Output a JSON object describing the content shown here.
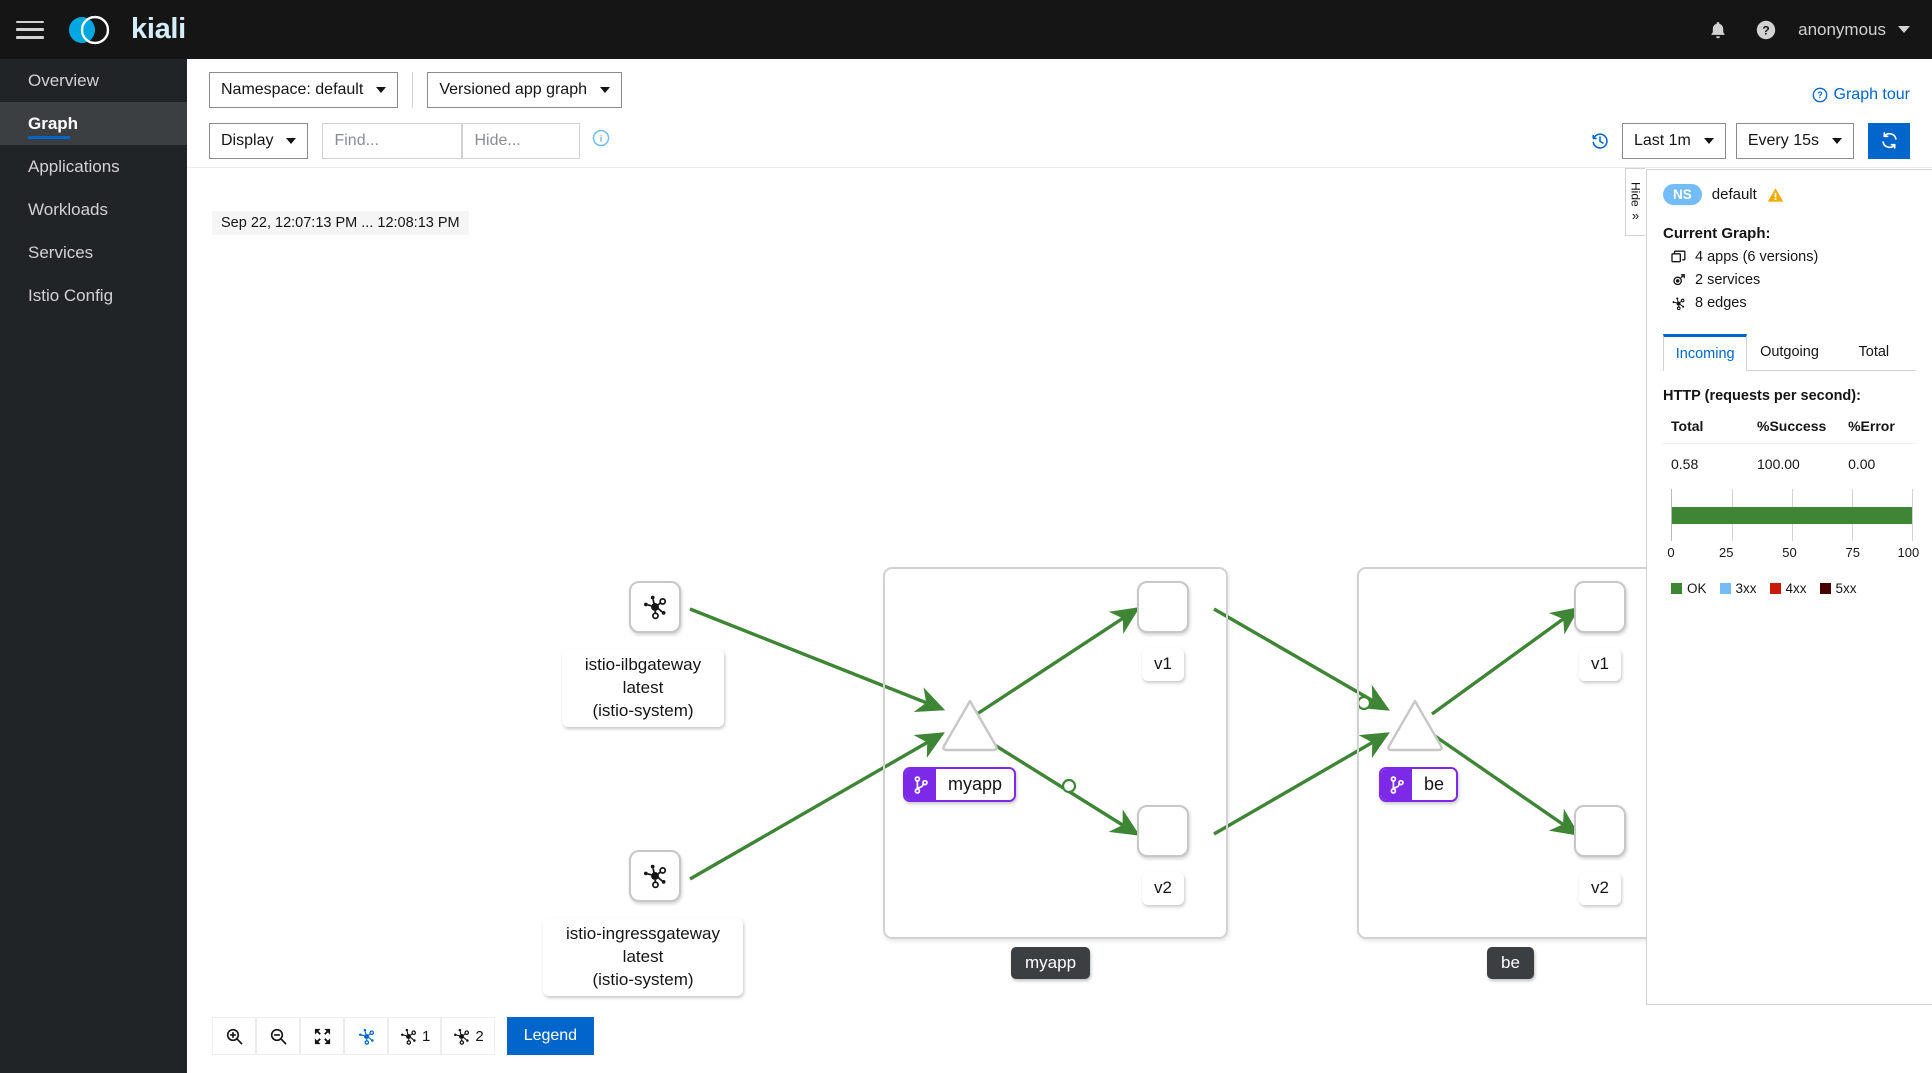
{
  "masthead": {
    "brand_name": "kiali",
    "hamburger_icon": "hamburger-menu-icon",
    "bell_icon": "notification-bell-icon",
    "help_icon": "help-question-icon",
    "user_name": "anonymous"
  },
  "sidebar": {
    "items": [
      {
        "label": "Overview",
        "active": false
      },
      {
        "label": "Graph",
        "active": true
      },
      {
        "label": "Applications",
        "active": false
      },
      {
        "label": "Workloads",
        "active": false
      },
      {
        "label": "Services",
        "active": false
      },
      {
        "label": "Istio Config",
        "active": false
      }
    ]
  },
  "toolbar": {
    "namespace_label": "Namespace: default",
    "graph_type_label": "Versioned app graph",
    "display_label": "Display",
    "find_placeholder": "Find...",
    "hide_placeholder": "Hide...",
    "find_value": "",
    "hide_value": "",
    "info_icon": "info-circle-icon",
    "graph_tour_label": "Graph tour",
    "graph_tour_icon": "help-question-icon",
    "history_icon": "clock-history-icon",
    "duration_label": "Last 1m",
    "refresh_interval_label": "Every 15s",
    "refresh_icon": "refresh-sync-icon"
  },
  "graph": {
    "timestamp": "Sep 22, 12:07:13 PM ... 12:08:13 PM",
    "gateways": [
      {
        "id": "istio-ilbgateway",
        "icon": "topology-node-icon",
        "label": "istio-ilbgateway\nlatest\n(istio-system)"
      },
      {
        "id": "istio-ingressgateway",
        "icon": "topology-node-icon",
        "label": "istio-ingressgateway\nlatest\n(istio-system)"
      }
    ],
    "apps": [
      {
        "id": "myapp",
        "group_label": "myapp",
        "service_label": "myapp",
        "service_badge_icon": "git-branch-icon",
        "versions": [
          "v1",
          "v2"
        ]
      },
      {
        "id": "be",
        "group_label": "be",
        "service_label": "be",
        "service_badge_icon": "git-branch-icon",
        "versions": [
          "v1",
          "v2"
        ]
      }
    ],
    "edge_color": "#3e8635",
    "bottom_toolbar": {
      "zoom_in_icon": "zoom-in-icon",
      "zoom_out_icon": "zoom-out-icon",
      "fit_screen_icon": "expand-arrows-icon",
      "layout_default_icon": "topology-layout-icon",
      "layout_1_icon": "topology-layout-icon",
      "layout_1_label": "1",
      "layout_2_icon": "topology-layout-icon",
      "layout_2_label": "2",
      "legend_label": "Legend"
    }
  },
  "hide_tab": {
    "label": "Hide",
    "chevron_icon": "double-chevron-right-icon"
  },
  "side_panel": {
    "ns_badge": "NS",
    "ns_name": "default",
    "warning_icon": "warning-triangle-icon",
    "current_graph_title": "Current Graph:",
    "stats": [
      {
        "icon": "apps-stack-icon",
        "label": "4 apps (6 versions)"
      },
      {
        "icon": "service-icon",
        "label": "2 services"
      },
      {
        "icon": "edges-topology-icon",
        "label": "8 edges"
      }
    ],
    "tabs": [
      {
        "label": "Incoming",
        "active": true
      },
      {
        "label": "Outgoing",
        "active": false
      },
      {
        "label": "Total",
        "active": false
      }
    ],
    "http_title": "HTTP (requests per second):",
    "metrics_headers": [
      "Total",
      "%Success",
      "%Error"
    ],
    "metrics_values": [
      "0.58",
      "100.00",
      "0.00"
    ],
    "chart_data": {
      "type": "bar",
      "orientation": "horizontal",
      "title": "",
      "xlabel": "",
      "ylabel": "",
      "categories": [
        ""
      ],
      "series": [
        {
          "name": "OK",
          "values": [
            100
          ],
          "color": "#3e8635"
        },
        {
          "name": "3xx",
          "values": [
            0
          ],
          "color": "#73bcf7"
        },
        {
          "name": "4xx",
          "values": [
            0
          ],
          "color": "#c9190b"
        },
        {
          "name": "5xx",
          "values": [
            0
          ],
          "color": "#470000"
        }
      ],
      "xlim": [
        0,
        100
      ],
      "xticks": [
        0,
        25,
        50,
        75,
        100
      ],
      "grid": true,
      "legend_position": "bottom"
    }
  }
}
